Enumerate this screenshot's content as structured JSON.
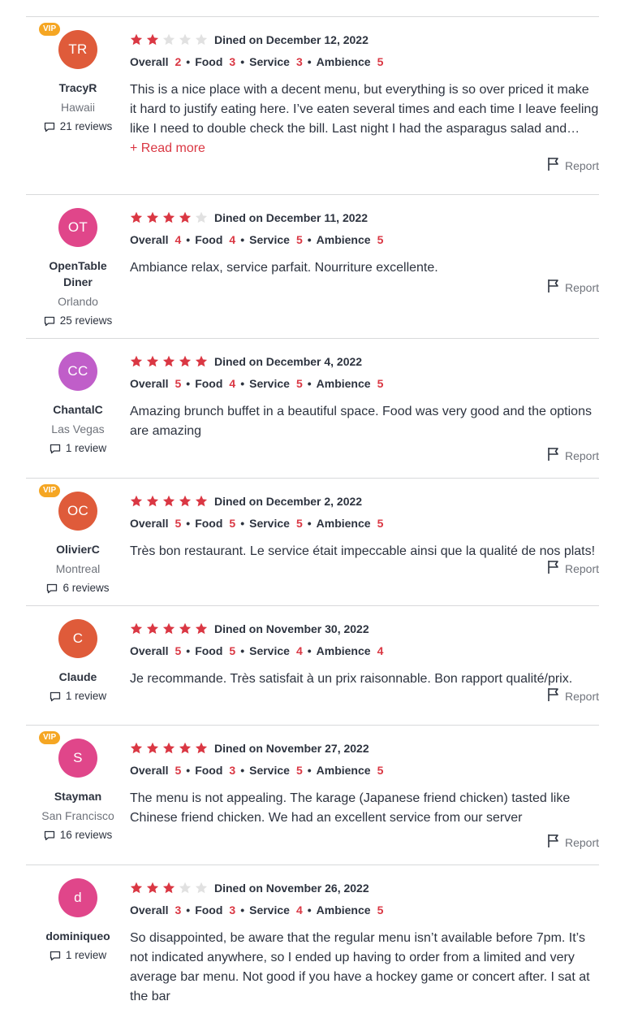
{
  "report_label": "Report",
  "read_more_label": "+ Read more",
  "colors": {
    "star_filled": "#da3743",
    "star_empty": "#e1e1e1",
    "vip": "#f5a623"
  },
  "reviews": [
    {
      "vip": false,
      "initials": "",
      "avatar_color": "#ffffff",
      "name": "",
      "city": "",
      "review_count": "",
      "stars": 0,
      "dined": "",
      "ratings": null,
      "text": ""
    },
    {
      "vip": true,
      "initials": "TR",
      "avatar_color": "#df5b3a",
      "name": "TracyR",
      "city": "Hawaii",
      "review_count": "21 reviews",
      "stars": 2,
      "dined": "Dined on December 12, 2022",
      "ratings": {
        "overall": "2",
        "food": "3",
        "service": "3",
        "ambience": "5"
      },
      "text": "This is a nice place with a decent menu, but everything is so over priced it make it hard to justify eating here. I’ve eaten several times and each time I leave feeling like I need to double check the bill. Last night I had the asparagus salad and seared scallops.",
      "read_more": true
    },
    {
      "vip": false,
      "initials": "OT",
      "avatar_color": "#e0468a",
      "name": "OpenTable Diner",
      "city": "Orlando",
      "review_count": "25 reviews",
      "stars": 4,
      "dined": "Dined on December 11, 2022",
      "ratings": {
        "overall": "4",
        "food": "4",
        "service": "5",
        "ambience": "5"
      },
      "text": "Ambiance relax, service parfait. Nourriture excellente."
    },
    {
      "vip": false,
      "initials": "CC",
      "avatar_color": "#c05ec9",
      "name": "ChantalC",
      "city": "Las Vegas",
      "review_count": "1 review",
      "stars": 5,
      "dined": "Dined on December 4, 2022",
      "ratings": {
        "overall": "5",
        "food": "4",
        "service": "5",
        "ambience": "5"
      },
      "text": "Amazing brunch buffet in a beautiful space. Food was very good and the options are amazing"
    },
    {
      "vip": true,
      "initials": "OC",
      "avatar_color": "#df5b3a",
      "name": "OlivierC",
      "city": "Montreal",
      "review_count": "6 reviews",
      "stars": 5,
      "dined": "Dined on December 2, 2022",
      "ratings": {
        "overall": "5",
        "food": "5",
        "service": "5",
        "ambience": "5"
      },
      "text": "Très bon restaurant. Le service était impeccable ainsi que la qualité de nos plats!"
    },
    {
      "vip": false,
      "initials": "C",
      "avatar_color": "#df5b3a",
      "name": "Claude",
      "city": "",
      "review_count": "1 review",
      "stars": 5,
      "dined": "Dined on November 30, 2022",
      "ratings": {
        "overall": "5",
        "food": "5",
        "service": "4",
        "ambience": "4"
      },
      "text": "Je recommande. Très satisfait à un prix raisonnable. Bon rapport qualité/prix."
    },
    {
      "vip": true,
      "initials": "S",
      "avatar_color": "#e0468a",
      "name": "Stayman",
      "city": "San Francisco",
      "review_count": "16 reviews",
      "stars": 5,
      "dined": "Dined on November 27, 2022",
      "ratings": {
        "overall": "5",
        "food": "3",
        "service": "5",
        "ambience": "5"
      },
      "text": "The menu is not appealing. The karage (Japanese friend chicken) tasted like Chinese friend chicken. We had an excellent service from our server"
    },
    {
      "vip": false,
      "initials": "d",
      "avatar_color": "#e0468a",
      "name": "dominiqueo",
      "city": "",
      "review_count": "1 review",
      "stars": 3,
      "dined": "Dined on November 26, 2022",
      "ratings": {
        "overall": "3",
        "food": "3",
        "service": "4",
        "ambience": "5"
      },
      "text": "So disappointed, be aware that the regular menu isn’t available before 7pm. It’s not indicated anywhere, so I ended up having to order from a limited and very average bar menu. Not good if you have a hockey game or concert after. I sat at the bar"
    }
  ],
  "rating_labels": {
    "overall": "Overall",
    "food": "Food",
    "service": "Service",
    "ambience": "Ambience"
  }
}
